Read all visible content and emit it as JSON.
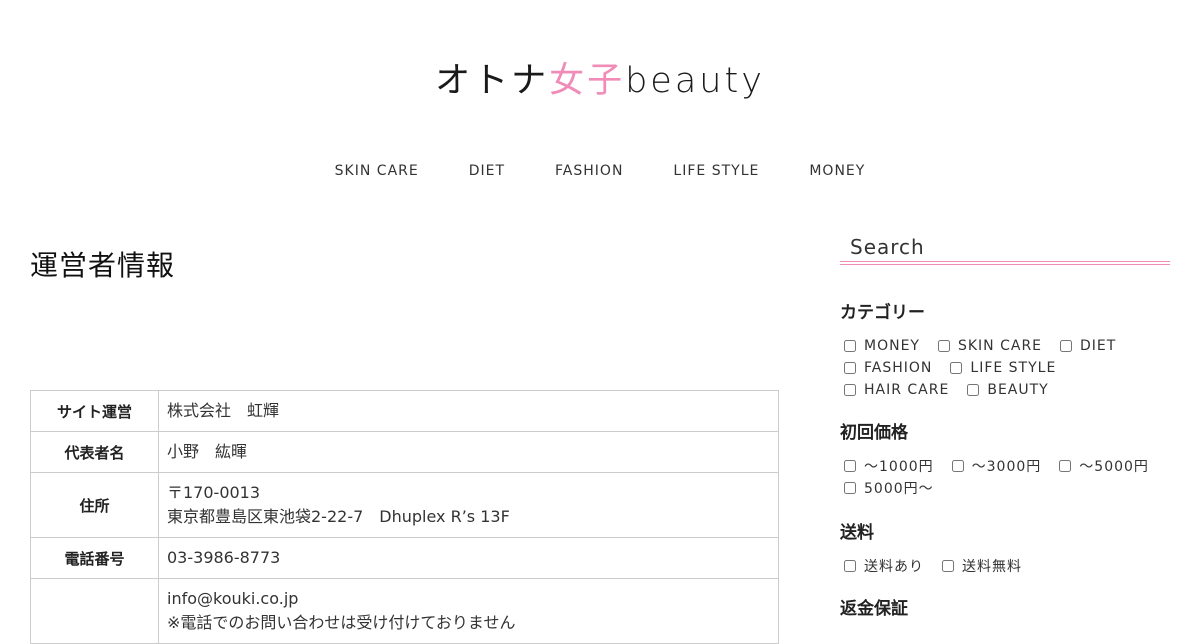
{
  "logo": {
    "part1": "オトナ",
    "part2": "女子",
    "part3": "beauty"
  },
  "nav": [
    "SKIN CARE",
    "DIET",
    "FASHION",
    "LIFE STYLE",
    "MONEY"
  ],
  "page_title": "運営者情報",
  "info_table": {
    "site_label": "サイト運営",
    "site_value": "株式会社　虹輝",
    "rep_label": "代表者名",
    "rep_value": "小野　紘暉",
    "address_label": "住所",
    "address_line1": "〒170-0013",
    "address_line2": "東京都豊島区東池袋2-22-7　Dhuplex R’s 13F",
    "phone_label": "電話番号",
    "phone_value": "03-3986-8773",
    "email_value": "info@kouki.co.jp",
    "email_note": "※電話でのお問い合わせは受け付けておりません"
  },
  "sidebar": {
    "search_placeholder": "Search",
    "category_heading": "カテゴリー",
    "categories": [
      "MONEY",
      "SKIN CARE",
      "DIET",
      "FASHION",
      "LIFE STYLE",
      "HAIR CARE",
      "BEAUTY"
    ],
    "price_heading": "初回価格",
    "prices": [
      "～1000円",
      "～3000円",
      "～5000円",
      "5000円～"
    ],
    "shipping_heading": "送料",
    "shipping": [
      "送料あり",
      "送料無料"
    ],
    "refund_heading": "返金保証"
  },
  "colors": {
    "accent": "#f08cb8"
  }
}
